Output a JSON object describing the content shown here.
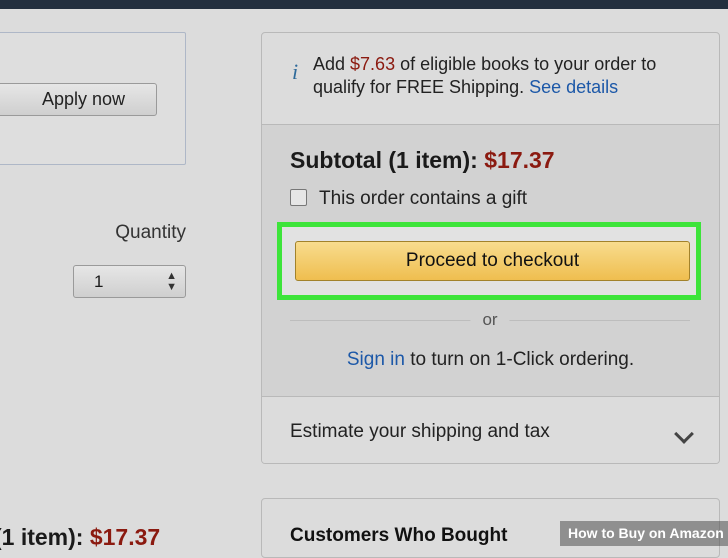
{
  "left": {
    "apply_label": "Apply now",
    "quantity_label": "Quantity",
    "quantity_value": "1",
    "subtotal_label": "(1 item):",
    "subtotal_price": "$17.37"
  },
  "cart": {
    "shipping_note": {
      "prefix": "Add ",
      "amount": "$7.63",
      "suffix": " of eligible books to your order to qualify for FREE Shipping. ",
      "link": "See details"
    },
    "subtotal_label": "Subtotal (1 item):",
    "subtotal_price": "$17.37",
    "gift_label": "This order contains a gift",
    "checkout_label": "Proceed to checkout",
    "or_label": "or",
    "signin_link": "Sign in",
    "signin_suffix": " to turn on 1-Click ordering.",
    "estimate_label": "Estimate your shipping and tax"
  },
  "recs": {
    "title": "Customers Who Bought"
  },
  "watermark": "How to Buy on Amazon",
  "colors": {
    "price": "#8b1a10",
    "link": "#1c58a8",
    "highlight": "#3de43a",
    "checkout_button": "#efbe4f"
  },
  "icons": [
    "info-icon",
    "checkbox-icon",
    "select-arrows-icon",
    "chevron-down-icon"
  ]
}
